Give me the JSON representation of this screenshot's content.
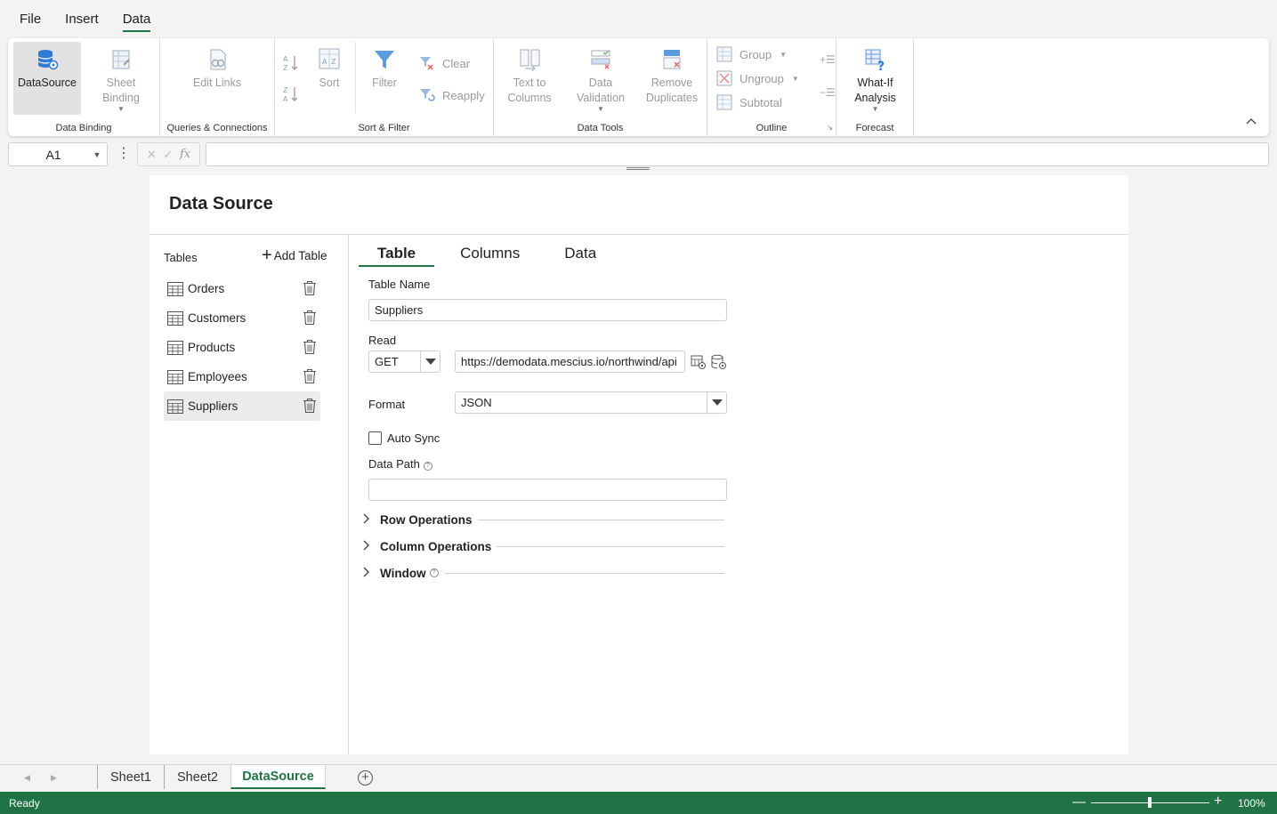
{
  "menu": {
    "items": [
      "File",
      "Insert",
      "Data"
    ],
    "active": "Data"
  },
  "ribbon": {
    "groups": {
      "data_binding": "Data Binding",
      "queries": "Queries & Connections",
      "sort_filter": "Sort & Filter",
      "data_tools": "Data Tools",
      "outline": "Outline",
      "forecast": "Forecast"
    },
    "buttons": {
      "datasource": "DataSource",
      "sheet_binding_1": "Sheet",
      "sheet_binding_2": "Binding",
      "edit_links": "Edit Links",
      "sort": "Sort",
      "filter": "Filter",
      "clear": "Clear",
      "reapply": "Reapply",
      "text_to_columns_1": "Text to",
      "text_to_columns_2": "Columns",
      "data_validation_1": "Data",
      "data_validation_2": "Validation",
      "remove_duplicates_1": "Remove",
      "remove_duplicates_2": "Duplicates",
      "group": "Group",
      "ungroup": "Ungroup",
      "subtotal": "Subtotal",
      "what_if_1": "What-If",
      "what_if_2": "Analysis"
    }
  },
  "formula_bar": {
    "name_box": "A1",
    "formula": ""
  },
  "panel": {
    "title": "Data Source",
    "tables_label": "Tables",
    "add_table": "Add Table",
    "tables": [
      {
        "name": "Orders"
      },
      {
        "name": "Customers"
      },
      {
        "name": "Products"
      },
      {
        "name": "Employees"
      },
      {
        "name": "Suppliers"
      }
    ],
    "selected_table": "Suppliers",
    "tabs": [
      "Table",
      "Columns",
      "Data"
    ],
    "active_tab": "Table",
    "form": {
      "table_name_label": "Table Name",
      "table_name_value": "Suppliers",
      "read_label": "Read",
      "read_method": "GET",
      "read_url": "https://demodata.mescius.io/northwind/api",
      "format_label": "Format",
      "format_value": "JSON",
      "auto_sync_label": "Auto Sync",
      "data_path_label": "Data Path",
      "data_path_value": "",
      "sections": [
        "Row Operations",
        "Column Operations",
        "Window"
      ]
    }
  },
  "sheets": {
    "tabs": [
      "Sheet1",
      "Sheet2",
      "DataSource"
    ],
    "active": "DataSource"
  },
  "status": {
    "text": "Ready",
    "zoom": "100%",
    "zoom_level": 0.5
  },
  "colors": {
    "accent": "#217346",
    "ribbon_icon_blue": "#2f7bd6"
  }
}
